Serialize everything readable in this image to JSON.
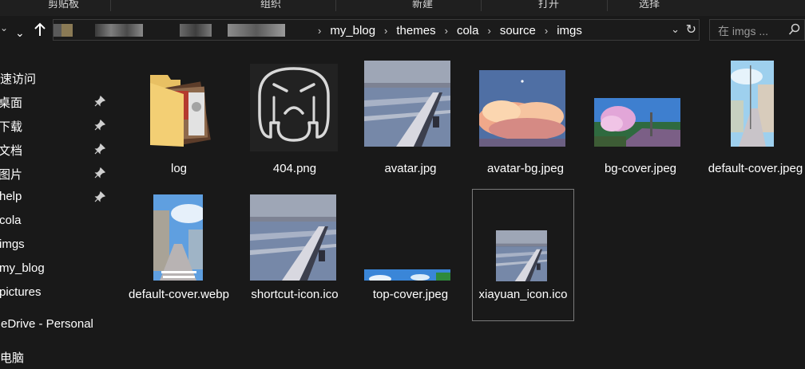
{
  "ribbon": {
    "groups": [
      "剪贴板",
      "组织",
      "新建",
      "打开",
      "选择"
    ]
  },
  "nav": {
    "back_icon": "chevron-down-icon",
    "up_icon": "arrow-up-icon",
    "breadcrumbs": [
      "my_blog",
      "themes",
      "cola",
      "source",
      "imgs"
    ],
    "search_placeholder": "在 imgs ..."
  },
  "sidebar": {
    "items": [
      {
        "label": "快速访问",
        "pinned": false
      },
      {
        "label": "桌面",
        "pinned": true
      },
      {
        "label": "下载",
        "pinned": true
      },
      {
        "label": "文档",
        "pinned": true
      },
      {
        "label": "图片",
        "pinned": true
      },
      {
        "label": "help",
        "pinned": true
      },
      {
        "label": "cola",
        "pinned": false
      },
      {
        "label": "imgs",
        "pinned": false
      },
      {
        "label": "my_blog",
        "pinned": false
      },
      {
        "label": "pictures",
        "pinned": false
      },
      {
        "label": "OneDrive - Personal",
        "pinned": false
      },
      {
        "label": "此电脑",
        "pinned": false
      }
    ]
  },
  "files": [
    {
      "name": "log",
      "type": "folder"
    },
    {
      "name": "404.png",
      "type": "image"
    },
    {
      "name": "avatar.jpg",
      "type": "image"
    },
    {
      "name": "avatar-bg.jpeg",
      "type": "image"
    },
    {
      "name": "bg-cover.jpeg",
      "type": "image"
    },
    {
      "name": "default-cover.jpeg",
      "type": "image"
    },
    {
      "name": "default-cover.webp",
      "type": "image"
    },
    {
      "name": "shortcut-icon.ico",
      "type": "image"
    },
    {
      "name": "top-cover.jpeg",
      "type": "image"
    },
    {
      "name": "xiayuan_icon.ico",
      "type": "image",
      "selected": true
    }
  ],
  "colors": {
    "background": "#191919",
    "text": "#ffffff",
    "border": "#3b3b3b",
    "selection_border": "#7a7a7a"
  }
}
